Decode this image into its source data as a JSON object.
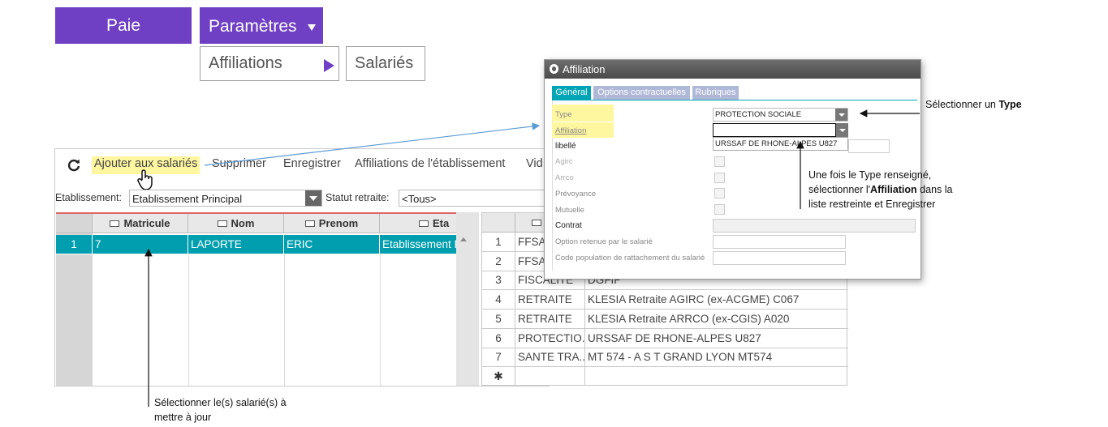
{
  "nav": {
    "paie": "Paie",
    "parametres": "Paramètres",
    "affiliations": "Affiliations",
    "salaries": "Salariés"
  },
  "toolbar": {
    "ajouter": "Ajouter aux salariés",
    "supprimer": "Supprimer",
    "enregistrer": "Enregistrer",
    "affiliations_etab": "Affiliations de l'établissement",
    "vid": "Vid"
  },
  "filters": {
    "etab_label": "Etablissement:",
    "etab_value": "Etablissement Principal",
    "statut_label": "Statut retraite:",
    "statut_value": "<Tous>"
  },
  "employees": {
    "columns": [
      "Matricule",
      "Nom",
      "Prenom",
      "Eta"
    ],
    "rows": [
      {
        "num": "1",
        "matricule": "7",
        "nom": "LAPORTE",
        "prenom": "ERIC",
        "etab": "Etablissement P"
      }
    ]
  },
  "affiliations_grid": {
    "rows": [
      {
        "num": "1",
        "type": "FFSA",
        "name": ""
      },
      {
        "num": "2",
        "type": "FFSA",
        "name": ""
      },
      {
        "num": "3",
        "type": "FISCALITE",
        "name": "DGFIP"
      },
      {
        "num": "4",
        "type": "RETRAITE",
        "name": "KLESIA Retraite AGIRC (ex-ACGME) C067"
      },
      {
        "num": "5",
        "type": "RETRAITE",
        "name": "KLESIA Retraite ARRCO (ex-CGIS) A020"
      },
      {
        "num": "6",
        "type": "PROTECTIO...",
        "name": "URSSAF DE RHONE-ALPES U827"
      },
      {
        "num": "7",
        "type": "SANTE TRA...",
        "name": "MT 574 - A S T GRAND LYON MT574"
      }
    ],
    "new_row_marker": "✱"
  },
  "dialog": {
    "title": "Affiliation",
    "tabs": [
      "Général",
      "Options contractuelles",
      "Rubriques"
    ],
    "labels": {
      "type": "Type",
      "affiliation": "Affiliation",
      "libelle": "libellé",
      "agirc": "Agirc",
      "arrco": "Arrco",
      "prevoyance": "Prévoyance",
      "mutuelle": "Mutuelle",
      "contrat": "Contrat",
      "option": "Option retenue par le salarié",
      "code_pop": "Code population de rattachement du salarié"
    },
    "type_value": "PROTECTION SOCIALE",
    "affiliation_value": "",
    "dropdown_option": "URSSAF DE RHONE-ALPES U827"
  },
  "callouts": {
    "type_prefix": "Sélectionner un ",
    "type_bold": "Type",
    "affil_line1": "Une fois le Type renseigné,",
    "affil_line2_prefix": "sélectionner l'",
    "affil_line2_bold": "Affiliation",
    "affil_line2_suffix": " dans la",
    "affil_line3": "liste restreinte et Enregistrer",
    "sal_line1": "Sélectionner le(s) salarié(s) à",
    "sal_line2": "mettre à jour"
  },
  "colors": {
    "accent": "#6f3fc4",
    "teal": "#00a5b5",
    "selected_row": "#009eae",
    "highlight": "#fff7a0"
  }
}
